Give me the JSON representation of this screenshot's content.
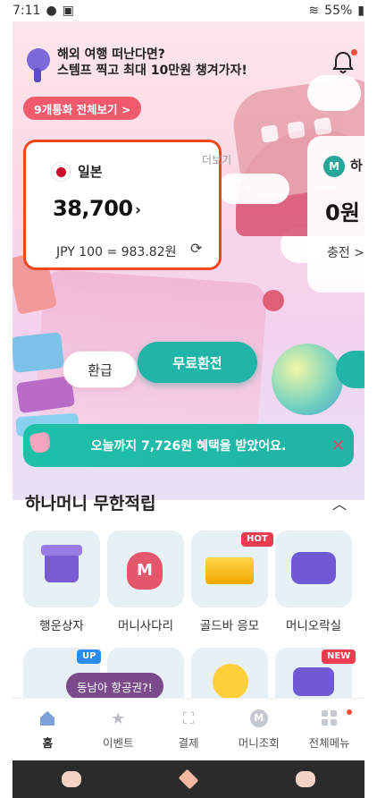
{
  "status_bar": {
    "time": "7:11",
    "battery": "55%"
  },
  "promo": {
    "line1": "해외 여행 떠난다면?",
    "line2": "스템프 찍고 최대 10만원 챙겨가자!"
  },
  "currency_pill": "9개통화 전체보기 >",
  "more_label": "더보기",
  "card_main": {
    "country": "일본",
    "amount": "38,700",
    "rate": "JPY 100 = 983.82원"
  },
  "card_second": {
    "logo": "M",
    "name": "하",
    "amount": "0원",
    "charge": "충전 >"
  },
  "buttons": {
    "refund": "환급",
    "exchange": "무료환전"
  },
  "benefit_text": "오늘까지 7,726원 혜택을 받았어요.",
  "section": {
    "title": "하나머니 무한적립",
    "tiles": [
      {
        "label": "행운상자",
        "icon": "gift-box-icon"
      },
      {
        "label": "머니사다리",
        "icon": "money-bag-ladder-icon",
        "tile_text": "M"
      },
      {
        "label": "골드바 응모",
        "icon": "gold-bar-icon",
        "tag": "HOT"
      },
      {
        "label": "머니오락실",
        "icon": "game-controller-icon"
      }
    ],
    "row2_tags": {
      "first": "UP",
      "last": "NEW"
    }
  },
  "tooltip": "동남아 항공권?!",
  "bottom_nav": [
    {
      "label": "홈",
      "icon": "home-icon",
      "active": true
    },
    {
      "label": "이벤트",
      "icon": "star-icon"
    },
    {
      "label": "결제",
      "icon": "scan-icon"
    },
    {
      "label": "머니조회",
      "icon": "money-icon",
      "icon_text": "M"
    },
    {
      "label": "전체메뉴",
      "icon": "grid-icon"
    }
  ]
}
